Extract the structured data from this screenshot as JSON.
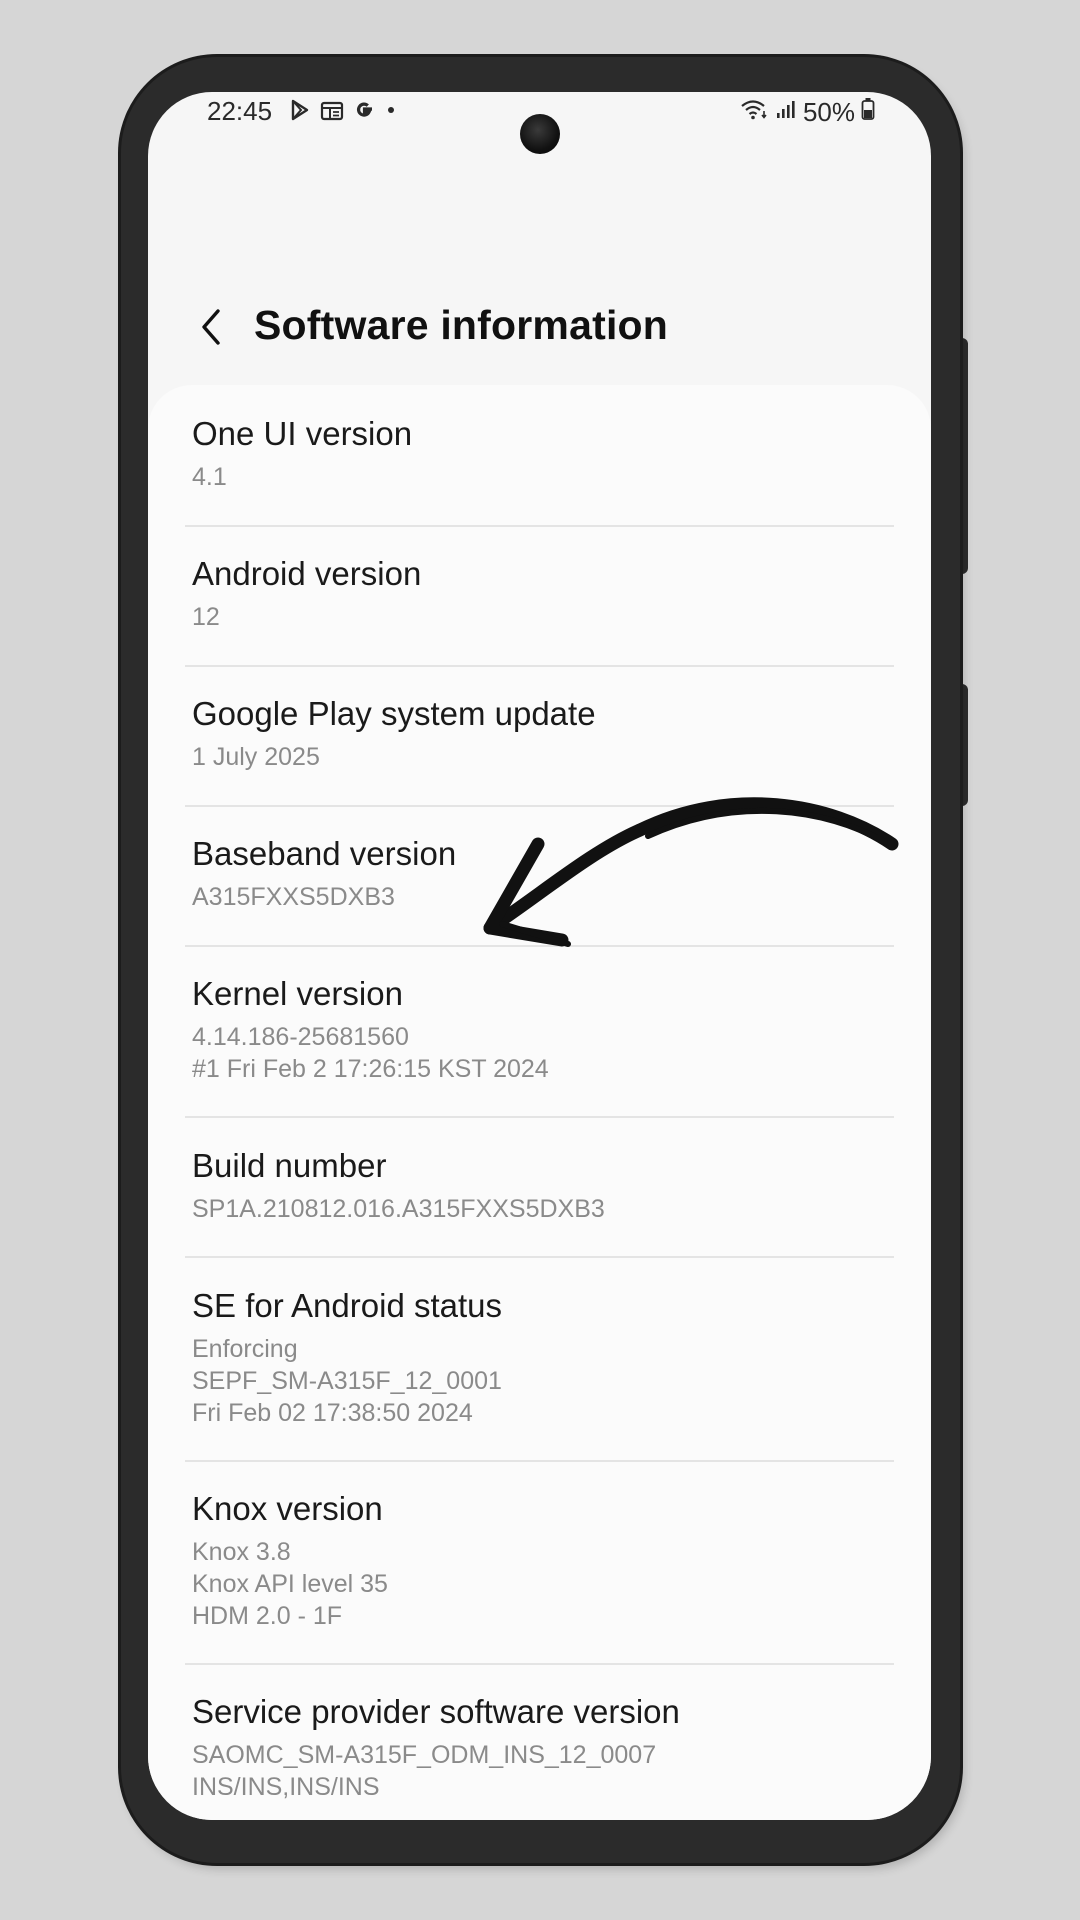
{
  "status_bar": {
    "time": "22:45",
    "left_icons": [
      "play-store-icon",
      "news-icon",
      "google-icon",
      "notification-dot-icon"
    ],
    "right_icons": [
      "wifi-icon",
      "signal-icon",
      "battery-icon"
    ],
    "battery": "50%"
  },
  "header": {
    "title": "Software information"
  },
  "items": [
    {
      "title": "One UI version",
      "values": [
        "4.1"
      ]
    },
    {
      "title": "Android version",
      "values": [
        "12"
      ]
    },
    {
      "title": "Google Play system update",
      "values": [
        "1 July 2025"
      ]
    },
    {
      "title": "Baseband version",
      "values": [
        "A315FXXS5DXB3"
      ]
    },
    {
      "title": "Kernel version",
      "values": [
        "4.14.186-25681560",
        "#1 Fri Feb 2 17:26:15 KST 2024"
      ]
    },
    {
      "title": "Build number",
      "values": [
        "SP1A.210812.016.A315FXXS5DXB3"
      ]
    },
    {
      "title": "SE for Android status",
      "values": [
        "Enforcing",
        "SEPF_SM-A315F_12_0001",
        "Fri Feb 02 17:38:50 2024"
      ]
    },
    {
      "title": "Knox version",
      "values": [
        "Knox 3.8",
        "Knox API level 35",
        "HDM 2.0 - 1F"
      ]
    },
    {
      "title": "Service provider software version",
      "values": [
        "SAOMC_SM-A315F_ODM_INS_12_0007",
        "INS/INS,INS/INS"
      ]
    }
  ],
  "nav_bar": {
    "buttons": [
      "recent-apps-icon",
      "home-icon",
      "back-icon"
    ]
  },
  "colors": {
    "background": "#d6d6d6",
    "screen": "#f6f6f6",
    "card": "#fbfbfb",
    "title_text": "#1a1a1a",
    "value_text": "#8a8a8a",
    "annotation": "#111111"
  }
}
